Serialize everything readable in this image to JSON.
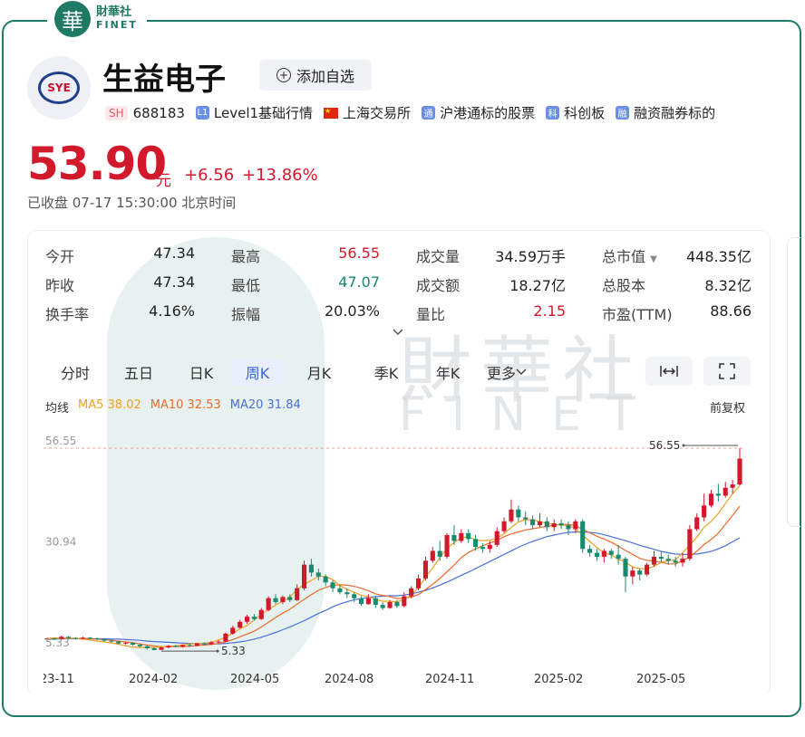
{
  "brand": {
    "seal_char": "華",
    "cn": "財華社",
    "en": "FINET"
  },
  "stock": {
    "name": "生益电子",
    "logo_text": "SYE",
    "market": "SH",
    "code": "688183",
    "tags": [
      {
        "badge": "L1",
        "text": "Level1基础行情"
      },
      {
        "badge": "flag",
        "text": "上海交易所"
      },
      {
        "badge": "通",
        "text": "沪港通标的股票"
      },
      {
        "badge": "科",
        "text": "科创板"
      },
      {
        "badge": "融",
        "text": "融资融券标的"
      }
    ],
    "add_watchlist": "添加自选",
    "price": "53.90",
    "unit": "元",
    "change": "+6.56",
    "change_pct": "+13.86%",
    "status": "已收盘  07-17 15:30:00 北京时间"
  },
  "watermark": {
    "cn": "財華社",
    "en": "FINET"
  },
  "stats": {
    "open": {
      "label": "今开",
      "value": "47.34"
    },
    "prev_close": {
      "label": "昨收",
      "value": "47.34"
    },
    "turnover_rate": {
      "label": "换手率",
      "value": "4.16%"
    },
    "high": {
      "label": "最高",
      "value": "56.55"
    },
    "low": {
      "label": "最低",
      "value": "47.07"
    },
    "amplitude": {
      "label": "振幅",
      "value": "20.03%"
    },
    "volume": {
      "label": "成交量",
      "value": "34.59万手"
    },
    "amount": {
      "label": "成交额",
      "value": "18.27亿"
    },
    "vol_ratio": {
      "label": "量比",
      "value": "2.15"
    },
    "market_cap": {
      "label": "总市值",
      "value": "448.35亿",
      "arrow": "▼"
    },
    "total_shares": {
      "label": "总股本",
      "value": "8.32亿"
    },
    "pe_ttm": {
      "label": "市盈(TTM)",
      "value": "88.66"
    }
  },
  "expand_icon": "chevron-down-icon",
  "periods": [
    "分时",
    "五日",
    "日K",
    "周K",
    "月K",
    "季K",
    "年K",
    "更多"
  ],
  "active_period": "周K",
  "tools": {
    "fit": "|↔|",
    "fullscreen": "⛶"
  },
  "ma": {
    "label": "均线",
    "ma5": "MA5 38.02",
    "ma10": "MA10 32.53",
    "ma20": "MA20 31.84",
    "colors": {
      "ma5": "#f0a020",
      "ma10": "#ee6a2a",
      "ma20": "#4a6fd8"
    }
  },
  "adjust": "前复权",
  "chart_data": {
    "type": "candlestick",
    "y_ticks": [
      "56.55",
      "30.94",
      "5.33"
    ],
    "ylim": [
      5.33,
      56.55
    ],
    "x_labels": [
      "23-11",
      "2024-02",
      "2024-05",
      "2024-08",
      "2024-11",
      "2025-02",
      "2025-05"
    ],
    "annotations": {
      "max": "56.55",
      "min": "5.33"
    },
    "up_color": "#d2192b",
    "down_color": "#1a8a6e",
    "candles": [
      [
        8.0,
        8.3,
        7.6,
        8.5
      ],
      [
        8.3,
        8.1,
        7.9,
        8.5
      ],
      [
        8.1,
        8.7,
        7.9,
        9.0
      ],
      [
        8.7,
        8.4,
        8.2,
        8.9
      ],
      [
        8.4,
        8.2,
        8.0,
        8.6
      ],
      [
        8.2,
        8.5,
        8.1,
        8.7
      ],
      [
        8.5,
        8.3,
        8.0,
        8.6
      ],
      [
        8.3,
        8.1,
        7.8,
        8.5
      ],
      [
        8.1,
        7.7,
        7.5,
        8.3
      ],
      [
        7.7,
        7.5,
        7.2,
        7.9
      ],
      [
        7.5,
        7.0,
        6.8,
        7.7
      ],
      [
        7.0,
        7.2,
        6.6,
        7.4
      ],
      [
        7.2,
        6.7,
        6.5,
        7.3
      ],
      [
        6.7,
        6.3,
        6.1,
        6.9
      ],
      [
        6.3,
        5.8,
        5.5,
        6.5
      ],
      [
        5.8,
        5.33,
        5.33,
        6.0
      ],
      [
        5.4,
        6.0,
        5.3,
        6.2
      ],
      [
        6.0,
        6.4,
        5.8,
        6.6
      ],
      [
        6.4,
        6.2,
        6.0,
        6.6
      ],
      [
        6.2,
        6.6,
        6.0,
        6.8
      ],
      [
        6.6,
        6.4,
        6.2,
        6.9
      ],
      [
        6.4,
        7.0,
        6.3,
        7.2
      ],
      [
        7.0,
        6.8,
        6.5,
        7.3
      ],
      [
        6.8,
        7.3,
        6.6,
        7.6
      ],
      [
        7.3,
        7.5,
        7.0,
        7.8
      ],
      [
        7.5,
        9.5,
        7.4,
        9.8
      ],
      [
        9.5,
        11.0,
        9.2,
        11.5
      ],
      [
        11.0,
        12.5,
        10.8,
        13.0
      ],
      [
        12.5,
        13.8,
        12.0,
        14.3
      ],
      [
        13.8,
        13.2,
        12.8,
        14.5
      ],
      [
        13.2,
        15.5,
        13.0,
        16.0
      ],
      [
        15.5,
        18.5,
        15.2,
        19.0
      ],
      [
        18.5,
        17.5,
        17.0,
        19.5
      ],
      [
        17.5,
        18.8,
        17.0,
        19.2
      ],
      [
        18.8,
        18.0,
        17.5,
        19.5
      ],
      [
        18.0,
        21.0,
        17.8,
        22.0
      ],
      [
        21.0,
        27.0,
        20.5,
        28.0
      ],
      [
        27.0,
        25.0,
        24.0,
        28.5
      ],
      [
        25.0,
        24.0,
        23.0,
        26.0
      ],
      [
        24.0,
        22.5,
        21.5,
        24.5
      ],
      [
        22.5,
        21.0,
        20.0,
        23.0
      ],
      [
        21.0,
        20.0,
        19.5,
        22.0
      ],
      [
        20.0,
        19.5,
        18.5,
        21.0
      ],
      [
        19.5,
        18.5,
        17.5,
        20.0
      ],
      [
        18.5,
        17.0,
        16.5,
        19.0
      ],
      [
        17.0,
        18.5,
        16.8,
        19.5
      ],
      [
        18.5,
        16.8,
        16.0,
        19.0
      ],
      [
        16.8,
        16.0,
        15.5,
        17.5
      ],
      [
        16.0,
        17.5,
        15.8,
        18.0
      ],
      [
        17.5,
        16.5,
        16.0,
        18.0
      ],
      [
        16.5,
        19.0,
        16.2,
        20.0
      ],
      [
        19.0,
        21.0,
        18.5,
        21.5
      ],
      [
        21.0,
        23.5,
        20.5,
        24.5
      ],
      [
        23.5,
        28.0,
        23.0,
        29.0
      ],
      [
        28.0,
        30.5,
        27.5,
        31.5
      ],
      [
        30.5,
        29.0,
        28.0,
        33.0
      ],
      [
        29.0,
        34.5,
        28.5,
        35.0
      ],
      [
        34.5,
        33.0,
        32.0,
        37.0
      ],
      [
        33.0,
        35.0,
        32.5,
        36.0
      ],
      [
        35.0,
        33.5,
        32.5,
        36.0
      ],
      [
        33.5,
        31.5,
        30.5,
        34.5
      ],
      [
        31.5,
        31.0,
        30.0,
        32.5
      ],
      [
        31.0,
        32.0,
        30.0,
        33.0
      ],
      [
        32.0,
        35.5,
        31.5,
        36.5
      ],
      [
        35.5,
        38.0,
        35.0,
        39.0
      ],
      [
        38.0,
        41.0,
        37.5,
        43.5
      ],
      [
        41.0,
        39.0,
        38.0,
        42.0
      ],
      [
        39.0,
        38.5,
        37.0,
        40.5
      ],
      [
        38.5,
        37.0,
        36.0,
        39.5
      ],
      [
        37.0,
        38.0,
        36.5,
        40.0
      ],
      [
        38.0,
        36.5,
        35.5,
        39.0
      ],
      [
        36.5,
        37.5,
        35.5,
        38.5
      ],
      [
        37.5,
        37.0,
        36.0,
        38.5
      ],
      [
        37.0,
        36.0,
        34.5,
        38.0
      ],
      [
        36.0,
        38.0,
        35.0,
        38.5
      ],
      [
        38.0,
        31.0,
        30.0,
        38.5
      ],
      [
        31.0,
        30.0,
        29.0,
        32.0
      ],
      [
        30.0,
        29.0,
        28.0,
        31.0
      ],
      [
        29.0,
        30.5,
        27.5,
        31.0
      ],
      [
        30.5,
        29.5,
        28.5,
        31.0
      ],
      [
        29.5,
        28.5,
        27.0,
        32.0
      ],
      [
        28.5,
        24.0,
        20.0,
        29.0
      ],
      [
        24.0,
        25.5,
        22.0,
        26.5
      ],
      [
        25.5,
        24.5,
        23.0,
        26.0
      ],
      [
        24.5,
        27.0,
        24.0,
        27.5
      ],
      [
        27.0,
        29.0,
        26.5,
        30.5
      ],
      [
        29.0,
        28.5,
        27.5,
        30.5
      ],
      [
        28.5,
        28.0,
        27.0,
        29.5
      ],
      [
        28.0,
        27.5,
        26.5,
        29.0
      ],
      [
        27.5,
        28.5,
        26.5,
        30.0
      ],
      [
        28.5,
        36.0,
        28.0,
        37.0
      ],
      [
        36.0,
        39.0,
        35.5,
        40.0
      ],
      [
        39.0,
        42.0,
        38.0,
        45.0
      ],
      [
        42.0,
        45.0,
        41.5,
        46.0
      ],
      [
        45.0,
        44.5,
        43.0,
        47.5
      ],
      [
        44.5,
        46.5,
        44.0,
        48.0
      ],
      [
        46.5,
        47.34,
        45.0,
        48.5
      ],
      [
        47.34,
        53.9,
        47.07,
        56.55
      ]
    ],
    "ma5": [
      8.3,
      8.4,
      8.4,
      8.4,
      8.3,
      8.1,
      7.9,
      7.6,
      7.4,
      7.1,
      6.8,
      6.4,
      6.1,
      6.0,
      6.0,
      6.0,
      6.2,
      6.3,
      6.4,
      6.6,
      6.9,
      7.0,
      7.1,
      7.3,
      7.9,
      8.6,
      9.6,
      10.7,
      11.6,
      12.9,
      14.4,
      15.6,
      16.8,
      17.7,
      18.8,
      20.7,
      22.0,
      23.0,
      24.0,
      24.0,
      23.2,
      21.7,
      20.7,
      20.0,
      19.2,
      18.9,
      18.2,
      17.7,
      17.7,
      17.6,
      18.1,
      19.3,
      21.2,
      23.8,
      26.2,
      28.8,
      31.1,
      32.6,
      33.9,
      34.0,
      33.3,
      33.1,
      33.2,
      33.7,
      34.8,
      36.5,
      37.8,
      38.4,
      38.4,
      37.9,
      37.5,
      37.2,
      37.0,
      37.0,
      36.1,
      34.5,
      32.9,
      31.3,
      30.0,
      29.5,
      28.4,
      27.6,
      26.4,
      26.0,
      25.9,
      26.6,
      27.6,
      28.0,
      28.2,
      30.0,
      32.0,
      34.0,
      36.5,
      38.0,
      40.0,
      42.5,
      45.0,
      47.0
    ],
    "ma10": [
      8.2,
      8.3,
      8.3,
      8.3,
      8.3,
      8.3,
      8.2,
      8.1,
      8.0,
      7.8,
      7.6,
      7.4,
      7.2,
      6.9,
      6.6,
      6.4,
      6.2,
      6.2,
      6.2,
      6.2,
      6.3,
      6.5,
      6.6,
      6.8,
      7.0,
      7.4,
      8.0,
      8.7,
      9.4,
      10.1,
      11.2,
      12.4,
      13.6,
      14.7,
      15.7,
      17.0,
      18.2,
      19.4,
      20.5,
      21.2,
      21.8,
      21.9,
      21.8,
      21.5,
      21.0,
      20.4,
      19.6,
      19.2,
      18.9,
      18.4,
      18.5,
      18.8,
      19.4,
      20.7,
      22.0,
      23.5,
      25.2,
      26.9,
      28.8,
      30.1,
      31.0,
      31.8,
      32.5,
      33.1,
      34.1,
      34.8,
      35.3,
      35.8,
      36.1,
      36.4,
      36.7,
      37.0,
      37.2,
      37.2,
      36.9,
      36.0,
      35.1,
      34.2,
      33.5,
      32.7,
      31.7,
      30.6,
      29.6,
      28.6,
      28.1,
      27.9,
      27.6,
      27.2,
      27.2,
      28.0,
      29.0,
      30.4,
      32.1,
      33.4,
      35.0,
      37.2,
      39.5,
      41.8
    ],
    "ma20": [
      8.1,
      8.1,
      8.2,
      8.2,
      8.2,
      8.2,
      8.2,
      8.2,
      8.2,
      8.1,
      8.1,
      8.0,
      7.9,
      7.8,
      7.6,
      7.5,
      7.4,
      7.3,
      7.2,
      7.1,
      7.0,
      7.0,
      6.9,
      6.9,
      6.9,
      7.0,
      7.2,
      7.4,
      7.7,
      8.1,
      8.6,
      9.2,
      9.8,
      10.5,
      11.2,
      12.0,
      12.8,
      13.7,
      14.6,
      15.4,
      16.3,
      17.0,
      17.6,
      18.1,
      18.4,
      18.7,
      18.9,
      19.0,
      19.1,
      19.1,
      19.3,
      19.6,
      20.0,
      20.5,
      21.1,
      21.8,
      22.6,
      23.4,
      24.3,
      25.1,
      26.0,
      26.9,
      27.8,
      28.7,
      29.6,
      30.5,
      31.4,
      32.2,
      32.9,
      33.5,
      34.1,
      34.5,
      34.9,
      35.2,
      35.3,
      35.3,
      35.2,
      35.0,
      34.6,
      34.1,
      33.6,
      33.1,
      32.5,
      31.9,
      31.4,
      30.9,
      30.4,
      30.0,
      29.7,
      29.6,
      29.6,
      29.7,
      30.0,
      30.4,
      31.0,
      31.8,
      32.8,
      33.8
    ]
  }
}
